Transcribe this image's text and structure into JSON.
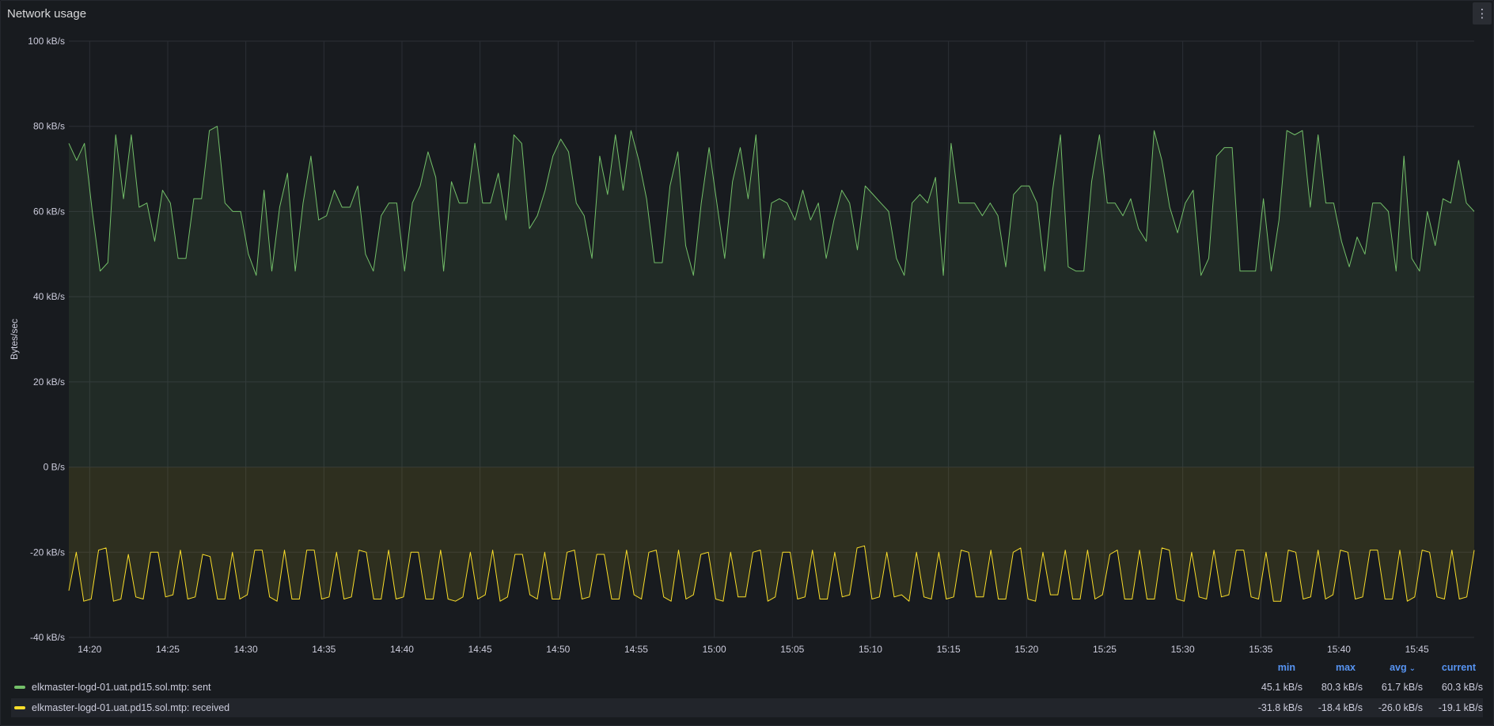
{
  "panel": {
    "title": "Network usage",
    "menu_icon": "⋮"
  },
  "colors": {
    "sent": "#73bf69",
    "received": "#fade2a",
    "grid": "#2c2f36",
    "axis_text": "#ccccdc",
    "header": "#5794f2"
  },
  "legend": {
    "headers": [
      "min",
      "max",
      "avg",
      "current"
    ],
    "sort_indicator": "avg",
    "rows": [
      {
        "name": "elkmaster-logd-01.uat.pd15.sol.mtp: sent",
        "min": "45.1 kB/s",
        "max": "80.3 kB/s",
        "avg": "61.7 kB/s",
        "current": "60.3 kB/s"
      },
      {
        "name": "elkmaster-logd-01.uat.pd15.sol.mtp: received",
        "min": "-31.8 kB/s",
        "max": "-18.4 kB/s",
        "avg": "-26.0 kB/s",
        "current": "-19.1 kB/s"
      }
    ]
  },
  "chart_data": {
    "type": "line",
    "ylabel": "Bytes/sec",
    "ylim": [
      -40,
      100
    ],
    "y_ticks": [
      "100 kB/s",
      "80 kB/s",
      "60 kB/s",
      "40 kB/s",
      "20 kB/s",
      "0 B/s",
      "-20 kB/s",
      "-40 kB/s"
    ],
    "y_tick_values": [
      100,
      80,
      60,
      40,
      20,
      0,
      -20,
      -40
    ],
    "x_ticks": [
      "14:20",
      "14:25",
      "14:30",
      "14:35",
      "14:40",
      "14:45",
      "14:50",
      "14:55",
      "15:00",
      "15:05",
      "15:10",
      "15:15",
      "15:20",
      "15:25",
      "15:30",
      "15:35",
      "15:40",
      "15:45"
    ],
    "x_start": "14:18:40",
    "x_end": "15:48:40",
    "grid": true,
    "fill": true,
    "series": [
      {
        "name": "elkmaster-logd-01.uat.pd15.sol.mtp: sent",
        "color": "#73bf69",
        "values": [
          76,
          72,
          76,
          60,
          46,
          48,
          78,
          63,
          78,
          61,
          62,
          53,
          65,
          62,
          49,
          49,
          63,
          63,
          79,
          80,
          62,
          60,
          60,
          50,
          45,
          65,
          46,
          61,
          69,
          46,
          62,
          73,
          58,
          59,
          65,
          61,
          61,
          66,
          50,
          46,
          59,
          62,
          62,
          46,
          62,
          66,
          74,
          68,
          46,
          67,
          62,
          62,
          76,
          62,
          62,
          69,
          58,
          78,
          76,
          56,
          59,
          65,
          73,
          77,
          74,
          62,
          59,
          49,
          73,
          64,
          78,
          65,
          79,
          72,
          63,
          48,
          48,
          66,
          74,
          52,
          45,
          62,
          75,
          62,
          49,
          67,
          75,
          63,
          78,
          49,
          62,
          63,
          62,
          58,
          65,
          58,
          62,
          49,
          58,
          65,
          62,
          51,
          66,
          64,
          62,
          60,
          49,
          45,
          62,
          64,
          62,
          68,
          45,
          76,
          62,
          62,
          62,
          59,
          62,
          59,
          47,
          64,
          66,
          66,
          62,
          46,
          65,
          78,
          47,
          46,
          46,
          67,
          78,
          62,
          62,
          59,
          63,
          56,
          53,
          79,
          72,
          61,
          55,
          62,
          65,
          45,
          49,
          73,
          75,
          75,
          46,
          46,
          46,
          63,
          46,
          58,
          79,
          78,
          79,
          61,
          78,
          62,
          62,
          53,
          47,
          54,
          50,
          62,
          62,
          60,
          46,
          73,
          49,
          46,
          60,
          52,
          63,
          62,
          72,
          62,
          60
        ]
      },
      {
        "name": "elkmaster-logd-01.uat.pd15.sol.mtp: received",
        "color": "#fade2a",
        "values": [
          -29,
          -20,
          -31.5,
          -31,
          -19.5,
          -19,
          -31.5,
          -31,
          -20.5,
          -30.5,
          -31,
          -20,
          -20,
          -30.5,
          -30,
          -19.5,
          -31,
          -30.5,
          -20.5,
          -21,
          -31,
          -31,
          -20,
          -31,
          -30,
          -19.5,
          -19.5,
          -30.5,
          -31.5,
          -19.5,
          -31,
          -31,
          -19.5,
          -19.5,
          -31,
          -30.5,
          -20,
          -31,
          -30.5,
          -19.5,
          -20,
          -31,
          -31,
          -19.5,
          -31,
          -30.5,
          -20,
          -20,
          -31,
          -31,
          -19.5,
          -31,
          -31.5,
          -30.5,
          -20,
          -31,
          -30,
          -19.5,
          -31.5,
          -30.5,
          -20.5,
          -20.5,
          -30,
          -31,
          -20,
          -31,
          -31,
          -20,
          -19.5,
          -31,
          -30.5,
          -20.5,
          -20.5,
          -31,
          -31,
          -19.5,
          -30,
          -31,
          -20,
          -19.5,
          -30.5,
          -31.5,
          -19.5,
          -31,
          -30,
          -20.5,
          -20,
          -31,
          -31.5,
          -20,
          -30.5,
          -30.5,
          -20,
          -19.5,
          -31.5,
          -30.5,
          -20,
          -20,
          -31,
          -30.5,
          -19.5,
          -31,
          -31,
          -20,
          -30.5,
          -30,
          -19,
          -18.5,
          -31,
          -30.5,
          -20,
          -30.5,
          -30,
          -31.5,
          -20,
          -30.5,
          -31,
          -20,
          -31,
          -30.5,
          -19.5,
          -20,
          -30.5,
          -30.5,
          -19.5,
          -31,
          -31,
          -20,
          -19,
          -31,
          -31.5,
          -20,
          -30,
          -30,
          -19.5,
          -31,
          -31,
          -19.5,
          -31,
          -30,
          -20.5,
          -19.5,
          -31,
          -31,
          -19.5,
          -31,
          -31,
          -19,
          -19.5,
          -31,
          -31.5,
          -20,
          -30.5,
          -31,
          -19.5,
          -30.5,
          -30,
          -19.5,
          -19.5,
          -30.5,
          -31,
          -20,
          -31.5,
          -31.5,
          -19.5,
          -20,
          -31,
          -30.5,
          -19.5,
          -31,
          -30,
          -19.5,
          -20,
          -31,
          -30.5,
          -19.5,
          -19.5,
          -31,
          -31,
          -19.5,
          -31.5,
          -30.5,
          -19.5,
          -20,
          -30.5,
          -31,
          -19.5,
          -31,
          -30.5,
          -19.5
        ]
      }
    ]
  }
}
